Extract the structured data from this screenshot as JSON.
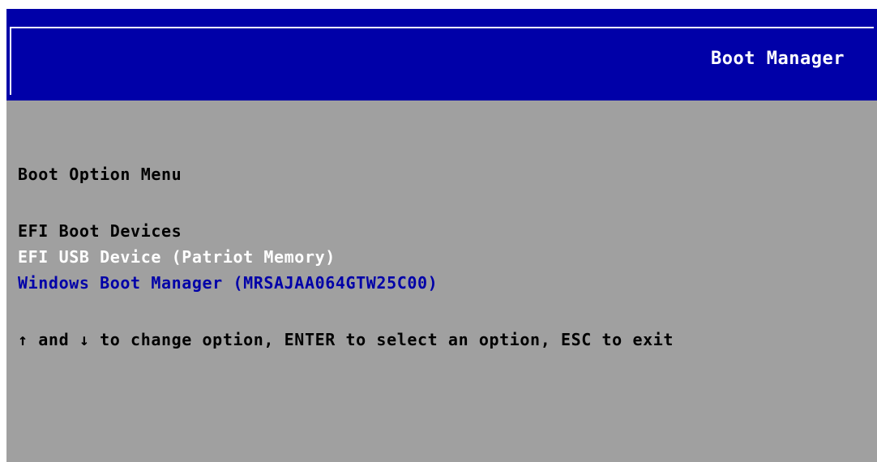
{
  "header": {
    "title": "Boot Manager"
  },
  "menu": {
    "title": "Boot Option Menu",
    "group_label": "EFI Boot Devices",
    "options": [
      {
        "label": "EFI USB Device (Patriot Memory)",
        "state": "highlighted"
      },
      {
        "label": "Windows Boot Manager (MRSAJAA064GTW25C00)",
        "state": "normal"
      }
    ]
  },
  "help": {
    "text": "↑ and ↓ to change option, ENTER to select an option, ESC to exit"
  },
  "colors": {
    "header_bg": "#0000a8",
    "body_bg": "#a0a0a0",
    "text_default": "#000000",
    "text_highlight": "#ffffff",
    "text_option": "#0000a8"
  }
}
